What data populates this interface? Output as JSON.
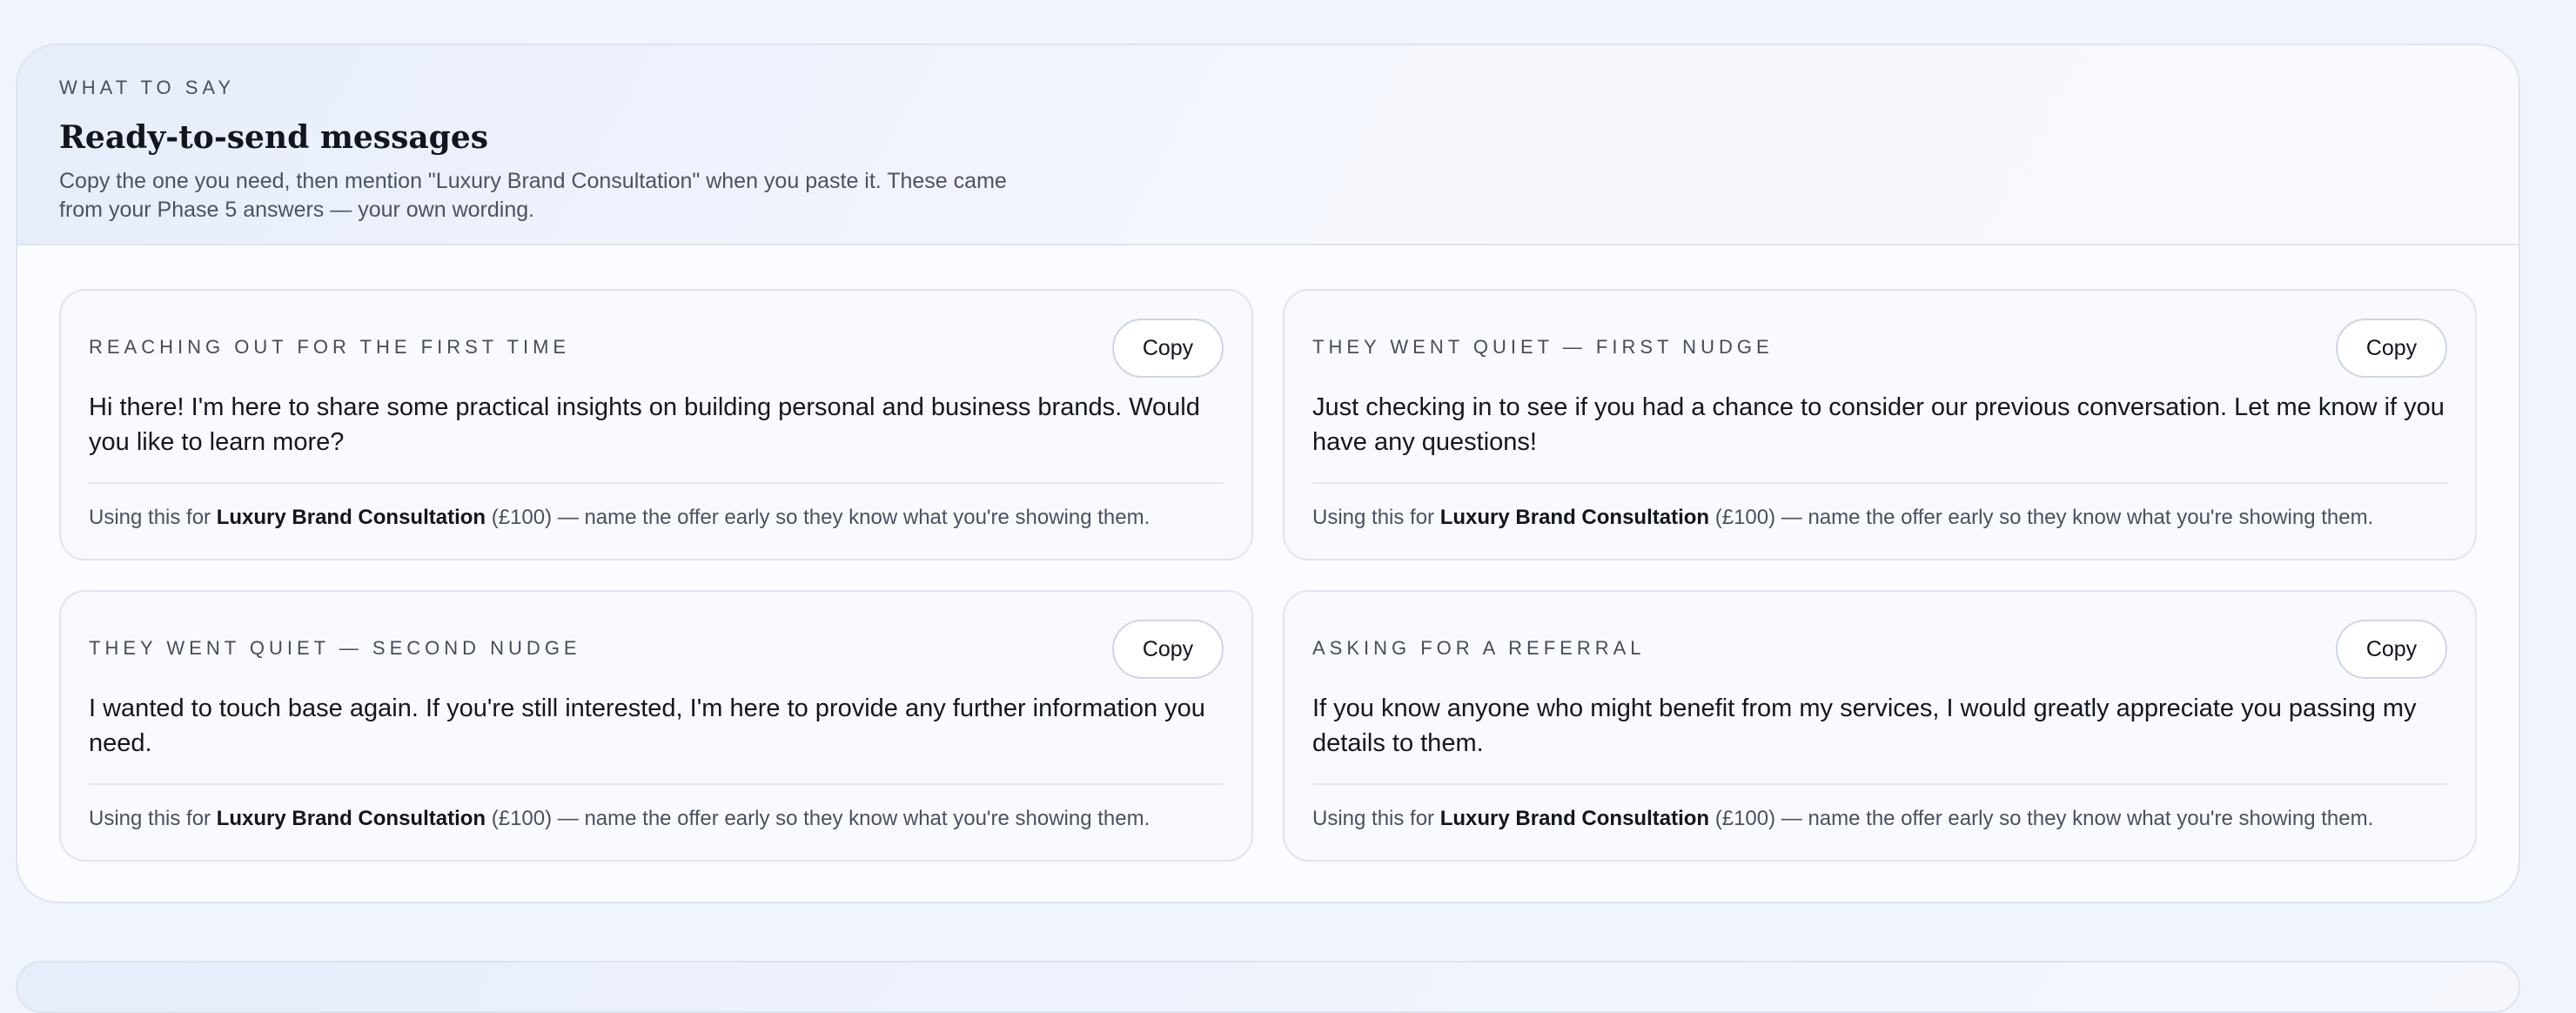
{
  "section": {
    "eyebrow": "WHAT TO SAY",
    "title": "Ready-to-send messages",
    "description": "Copy the one you need, then mention \"Luxury Brand Consultation\" when you paste it. These came from your Phase 5 answers — your own wording."
  },
  "copy_label": "Copy",
  "note": {
    "prefix": "Using this for ",
    "offer": "Luxury Brand Consultation",
    "suffix": " (£100) — name the offer early so they know what you're showing them."
  },
  "cards": [
    {
      "label": "REACHING OUT FOR THE FIRST TIME",
      "message": "Hi there! I'm here to share some practical insights on building personal and business brands. Would you like to learn more?"
    },
    {
      "label": "THEY WENT QUIET — FIRST NUDGE",
      "message": "Just checking in to see if you had a chance to consider our previous conversation. Let me know if you have any questions!"
    },
    {
      "label": "THEY WENT QUIET — SECOND NUDGE",
      "message": "I wanted to touch base again. If you're still interested, I'm here to provide any further information you need."
    },
    {
      "label": "ASKING FOR A REFERRAL",
      "message": "If you know anyone who might benefit from my services, I would greatly appreciate you passing my details to them."
    }
  ]
}
